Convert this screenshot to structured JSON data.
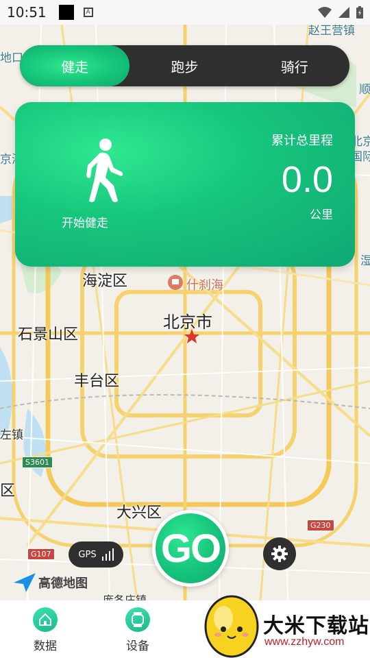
{
  "status_bar": {
    "time": "10:51",
    "a_badge": "A"
  },
  "mode_toggle": {
    "tabs": [
      "健走",
      "跑步",
      "骑行"
    ],
    "active_index": 0
  },
  "card": {
    "start_label": "开始健走",
    "total_label": "累计总里程",
    "total_value": "0.0",
    "unit": "公里"
  },
  "map": {
    "labels": {
      "haidian": "海淀区",
      "shichahai": "什刹海",
      "beijing": "北京市",
      "shijingshan": "石景山区",
      "fengtai": "丰台区",
      "daxing": "大兴区",
      "zuozhen": "左镇",
      "qu": "区",
      "xikou": "地口",
      "haizhen": "京海",
      "shun": "顺",
      "beijing_intl": "北京",
      "guoji": "国际",
      "zhaowang": "赵王营镇",
      "lu": "湿",
      "miaodian": "庞各庄镇"
    },
    "shields": {
      "s3601": "S3601",
      "g107": "G107",
      "g230": "G230"
    },
    "logo_text": "高德地图"
  },
  "gps": {
    "label": "GPS"
  },
  "go_button": {
    "label": "GO"
  },
  "bottom_nav": {
    "items": [
      {
        "label": "数据",
        "icon": "home-icon"
      },
      {
        "label": "设备",
        "icon": "watch-icon"
      }
    ]
  },
  "watermark": {
    "title": "大米下载站",
    "url": "www.zzhyw.com"
  },
  "colors": {
    "accent_green": "#17c67d",
    "dark_pill": "#2f2f2f",
    "watermark_red": "#c01e26"
  }
}
